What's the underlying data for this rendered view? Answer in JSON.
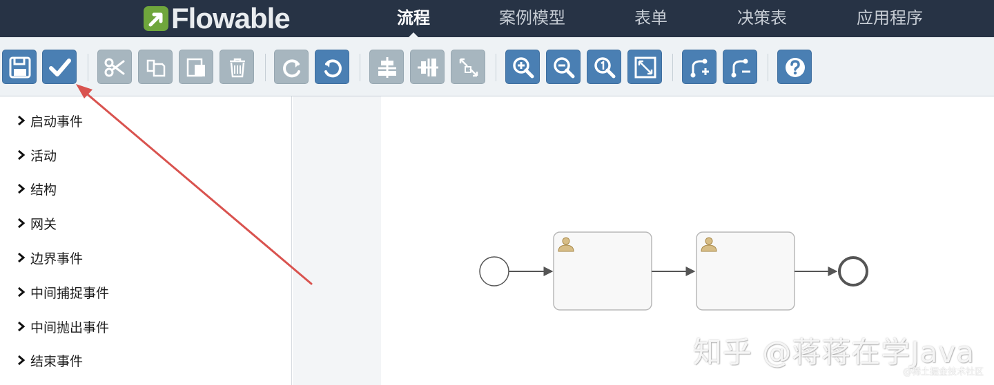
{
  "app": {
    "brand": "Flowable",
    "colors": {
      "topbar": "#273345",
      "accent": "#4a7fb3",
      "disabled": "#a7b6bf",
      "brand_green": "#6fa63c",
      "annotation_arrow": "#d9534f"
    }
  },
  "nav": {
    "items": [
      {
        "label": "流程",
        "active": true
      },
      {
        "label": "案例模型",
        "active": false
      },
      {
        "label": "表单",
        "active": false
      },
      {
        "label": "决策表",
        "active": false
      },
      {
        "label": "应用程序",
        "active": false
      }
    ]
  },
  "toolbar": {
    "buttons": [
      {
        "icon": "save-icon",
        "enabled": true
      },
      {
        "icon": "validate-check-icon",
        "enabled": true
      },
      {
        "icon": "cut-icon",
        "enabled": false
      },
      {
        "icon": "copy-icon",
        "enabled": false
      },
      {
        "icon": "paste-icon",
        "enabled": false
      },
      {
        "icon": "delete-icon",
        "enabled": false
      },
      {
        "icon": "redo-icon",
        "enabled": false
      },
      {
        "icon": "undo-icon",
        "enabled": true
      },
      {
        "icon": "align-horizontal-icon",
        "enabled": false
      },
      {
        "icon": "align-vertical-icon",
        "enabled": false
      },
      {
        "icon": "same-size-icon",
        "enabled": false
      },
      {
        "icon": "zoom-in-icon",
        "enabled": true
      },
      {
        "icon": "zoom-out-icon",
        "enabled": true
      },
      {
        "icon": "zoom-actual-icon",
        "enabled": true
      },
      {
        "icon": "zoom-fit-icon",
        "enabled": true
      },
      {
        "icon": "add-bendpoint-icon",
        "enabled": true
      },
      {
        "icon": "remove-bendpoint-icon",
        "enabled": true
      },
      {
        "icon": "help-icon",
        "enabled": true
      }
    ]
  },
  "palette": {
    "groups": [
      {
        "label": "启动事件"
      },
      {
        "label": "活动"
      },
      {
        "label": "结构"
      },
      {
        "label": "网关"
      },
      {
        "label": "边界事件"
      },
      {
        "label": "中间捕捉事件"
      },
      {
        "label": "中间抛出事件"
      },
      {
        "label": "结束事件"
      }
    ]
  },
  "diagram": {
    "elements": [
      "start-event",
      "user-task",
      "user-task",
      "end-event"
    ]
  },
  "watermark": {
    "main": "知乎 @蒋蒋在学Java",
    "sub": "@稀土掘金技术社区"
  }
}
